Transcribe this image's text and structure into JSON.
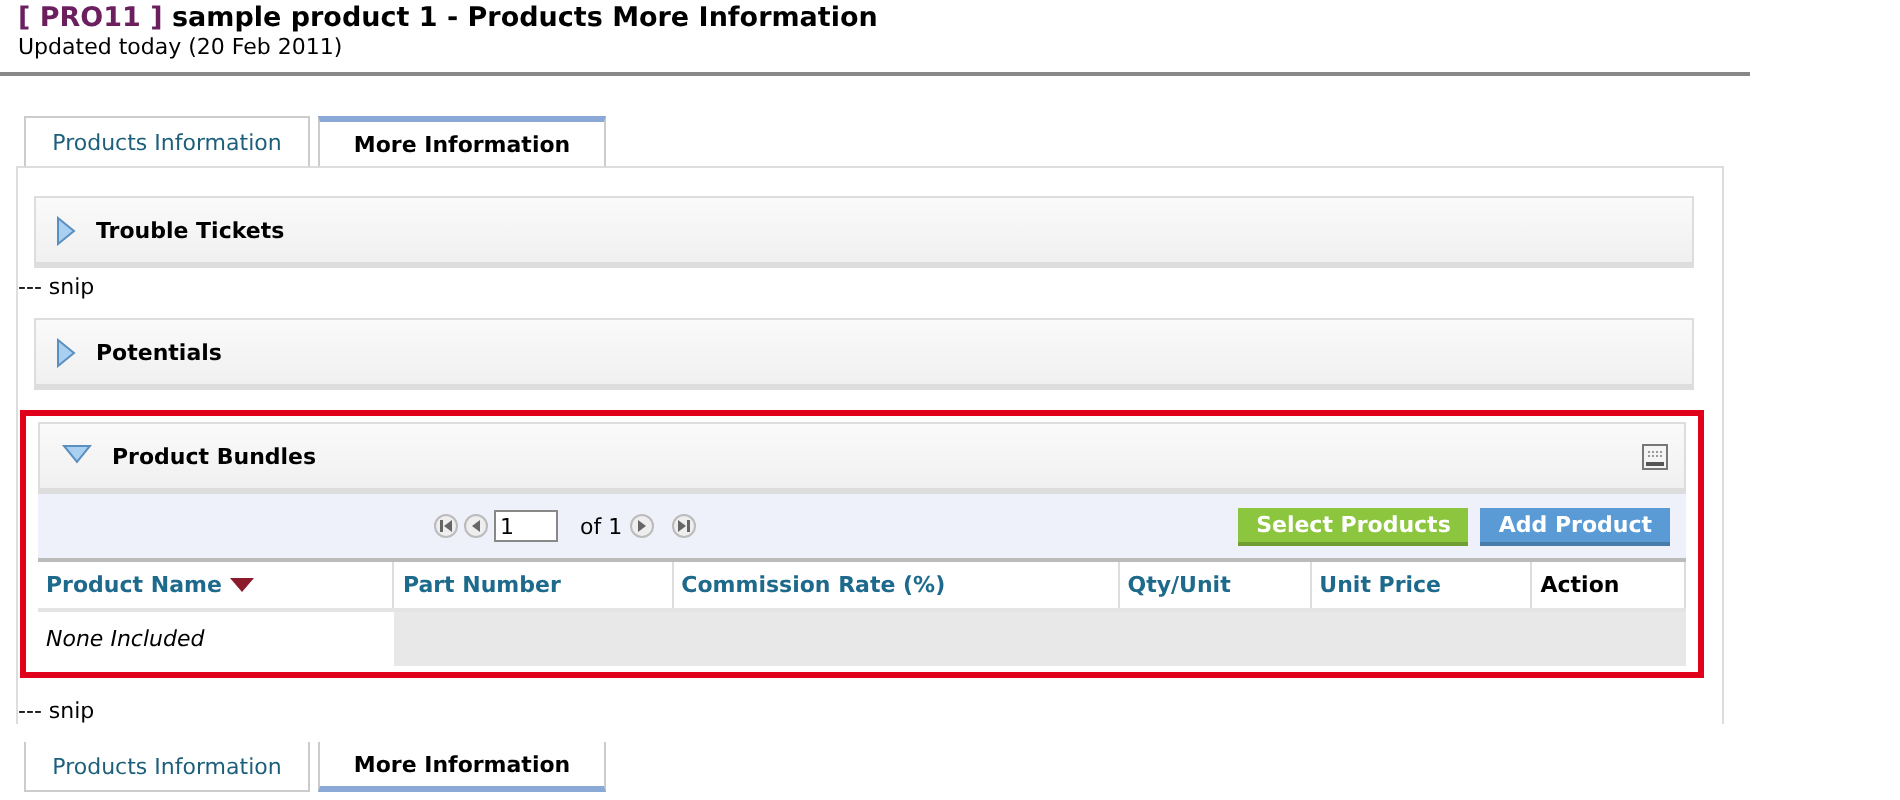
{
  "header": {
    "record_id": "[ PRO11 ]",
    "title": "sample product 1 - Products More Information",
    "updated": "Updated today (20 Feb 2011)"
  },
  "tabs_top": [
    {
      "label": "Products Information",
      "selected": false
    },
    {
      "label": "More Information",
      "selected": true
    }
  ],
  "blocks": [
    {
      "kind": "section",
      "title": "Trouble Tickets",
      "expanded": false
    },
    {
      "kind": "snip",
      "text": "--- snip"
    },
    {
      "kind": "section",
      "title": "Potentials",
      "expanded": false
    },
    {
      "kind": "bundle",
      "title": "Product Bundles",
      "expanded": true,
      "highlighted": true,
      "pager": {
        "page": "1",
        "of": "of 1"
      },
      "buttons": [
        {
          "label": "Select Products",
          "color": "#8cc63f"
        },
        {
          "label": "Add Product",
          "color": "#5b9bd5"
        }
      ],
      "columns": [
        {
          "label": "Product Name",
          "sortable": true,
          "sorted": true
        },
        {
          "label": "Part Number",
          "sortable": true,
          "sorted": false
        },
        {
          "label": "Commission Rate (%)",
          "sortable": true,
          "sorted": false
        },
        {
          "label": "Qty/Unit",
          "sortable": true,
          "sorted": false
        },
        {
          "label": "Unit Price",
          "sortable": true,
          "sorted": false
        },
        {
          "label": "Action",
          "sortable": false,
          "sorted": false
        }
      ],
      "empty_message": "None Included"
    },
    {
      "kind": "snip",
      "text": "--- snip"
    }
  ],
  "tabs_bottom": [
    {
      "label": "Products Information",
      "selected": false
    },
    {
      "label": "More Information",
      "selected": true
    }
  ]
}
